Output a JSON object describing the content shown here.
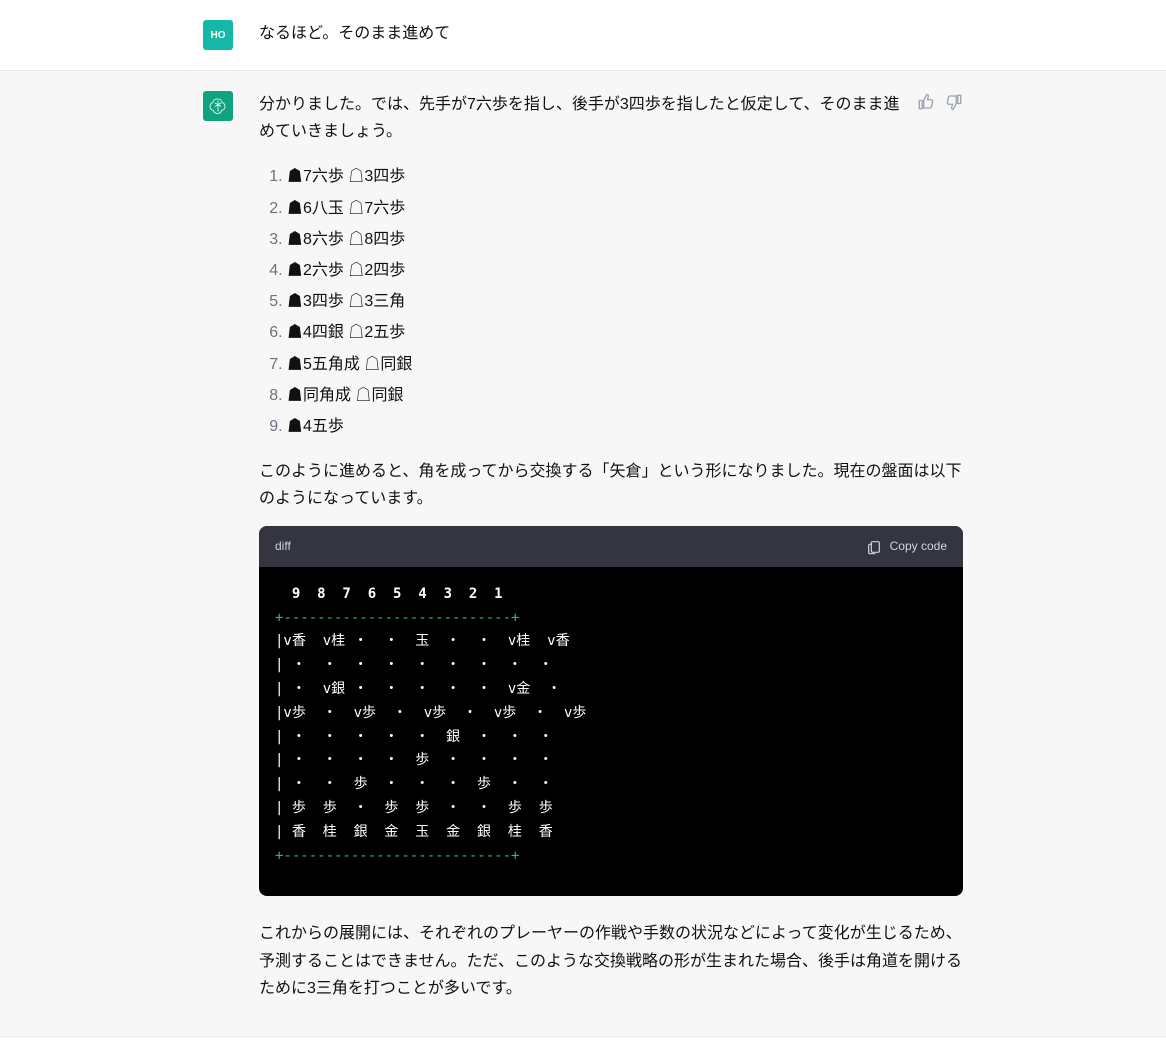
{
  "user": {
    "avatar_label": "HO",
    "text": "なるほど。そのまま進めて"
  },
  "assistant": {
    "intro": "分かりました。では、先手が7六歩を指し、後手が3四歩を指したと仮定して、そのまま進めていきましょう。",
    "moves": [
      "☗7六歩 ☖3四歩",
      "☗6八玉 ☖7六歩",
      "☗8六歩 ☖8四歩",
      "☗2六歩 ☖2四歩",
      "☗3四歩 ☖3三角",
      "☗4四銀 ☖2五歩",
      "☗5五角成 ☖同銀",
      "☗同角成 ☖同銀",
      "☗4五歩"
    ],
    "after": "このように進めると、角を成ってから交換する「矢倉」という形になりました。現在の盤面は以下のようになっています。",
    "code": {
      "lang": "diff",
      "copy_label": "Copy code",
      "header_row": "  9  8  7  6  5  4  3  2  1",
      "sep": "+---------------------------+",
      "rows": [
        "|v香  v桂 ・  ・  玉  ・  ・  v桂  v香",
        "| ・  ・  ・  ・  ・  ・  ・  ・  ・",
        "| ・  v銀 ・  ・  ・  ・  ・  v金  ・",
        "|v歩  ・  v歩  ・  v歩  ・  v歩  ・  v歩",
        "| ・  ・  ・  ・  ・  銀  ・  ・  ・",
        "| ・  ・  ・  ・  歩  ・  ・  ・  ・",
        "| ・  ・  歩  ・  ・  ・  歩  ・  ・",
        "| 歩  歩  ・  歩  歩  ・  ・  歩  歩",
        "| 香  桂  銀  金  玉  金  銀  桂  香"
      ]
    },
    "outro": "これからの展開には、それぞれのプレーヤーの作戦や手数の状況などによって変化が生じるため、予測することはできません。ただ、このような交換戦略の形が生まれた場合、後手は角道を開けるために3三角を打つことが多いです。"
  },
  "icons": {
    "thumbs_up": "thumbs-up-icon",
    "thumbs_down": "thumbs-down-icon",
    "clipboard": "clipboard-icon"
  }
}
